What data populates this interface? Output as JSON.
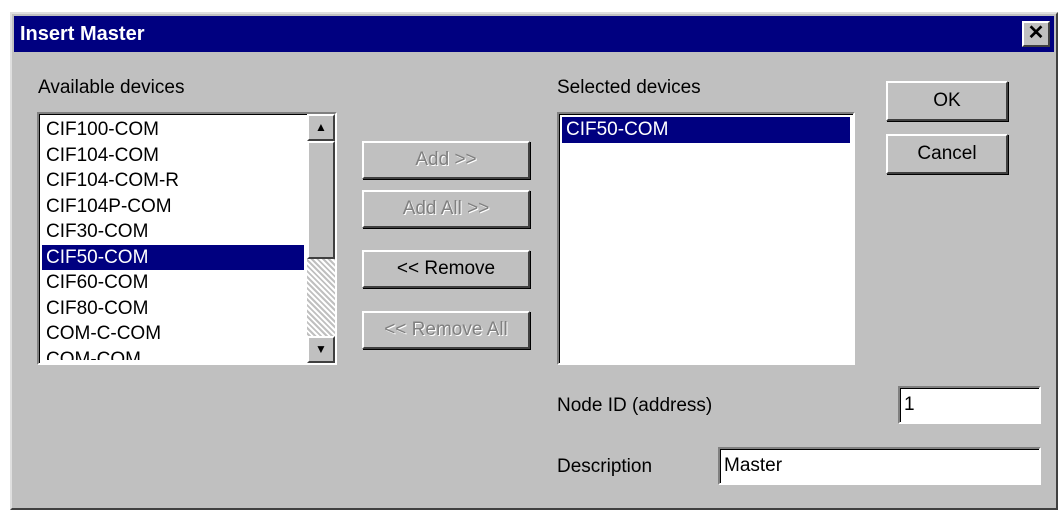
{
  "window": {
    "title": "Insert Master",
    "close_glyph": "✕"
  },
  "available": {
    "label": "Available devices",
    "items": [
      "CIF100-COM",
      "CIF104-COM",
      "CIF104-COM-R",
      "CIF104P-COM",
      "CIF30-COM",
      "CIF50-COM",
      "CIF60-COM",
      "CIF80-COM",
      "COM-C-COM",
      "COM-COM"
    ],
    "selected": "CIF50-COM"
  },
  "selected_devices": {
    "label": "Selected devices",
    "items": [
      "CIF50-COM"
    ]
  },
  "buttons": {
    "add": "Add >>",
    "add_all": "Add All >>",
    "remove": "<< Remove",
    "remove_all": "<< Remove All",
    "ok": "OK",
    "cancel": "Cancel"
  },
  "fields": {
    "node_id_label": "Node ID (address)",
    "node_id_value": "1",
    "description_label": "Description",
    "description_value": "Master"
  },
  "icons": {
    "scroll_up": "▲",
    "scroll_down": "▼"
  }
}
